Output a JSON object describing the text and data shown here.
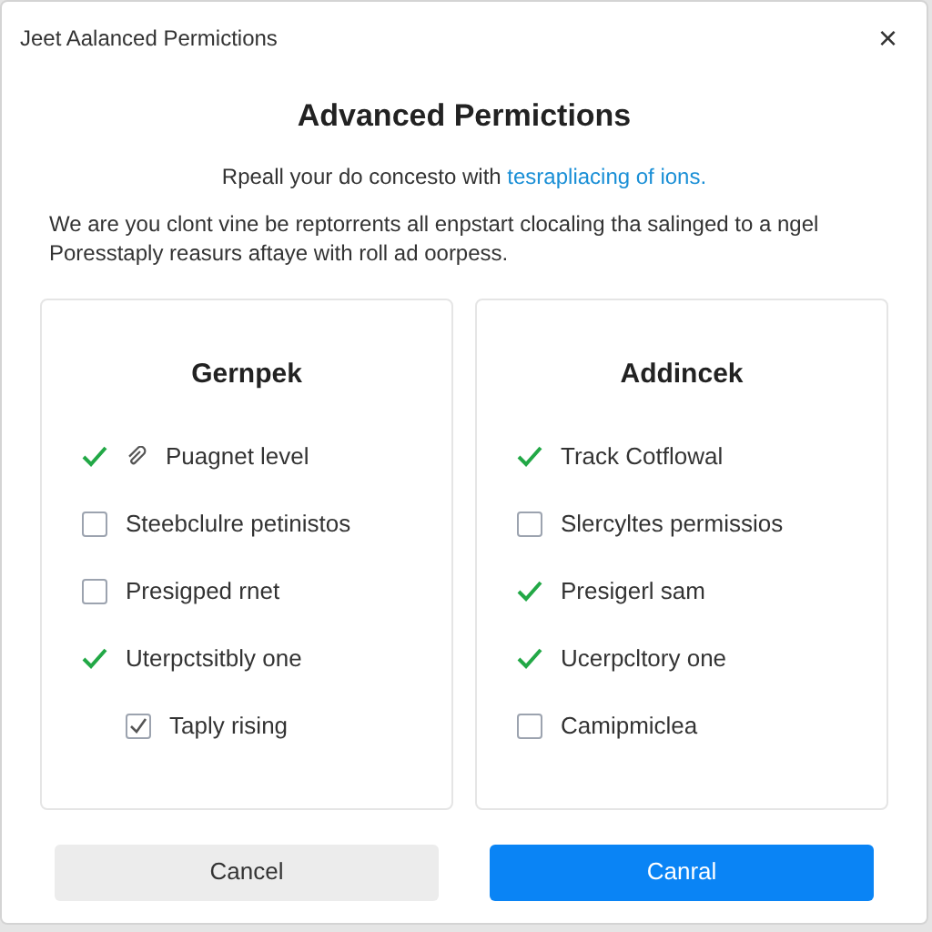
{
  "window": {
    "title": "Jeet Aalanced Permictions",
    "close": "×"
  },
  "heading": "Advanced Permictions",
  "subtitle": {
    "text": "Rpeall your do concesto with ",
    "link": "tesrapliacing of ions."
  },
  "description": "We are you clont vine be reptorrents all enpstart clocaling tha salinged to a ngel Poresstaply reasurs aftaye with roll ad oorpess.",
  "panels": [
    {
      "title": "Gernpek",
      "items": [
        {
          "kind": "attach",
          "label": "Puagnet level",
          "checked": true
        },
        {
          "kind": "box",
          "label": "Steebclulre petinistos",
          "checked": false
        },
        {
          "kind": "box",
          "label": "Presigped rnet",
          "checked": false
        },
        {
          "kind": "mark",
          "label": "Uterpctsitbly one",
          "checked": true,
          "children": [
            {
              "kind": "box",
              "label": "Taply rising",
              "checked": true
            }
          ]
        }
      ]
    },
    {
      "title": "Addincek",
      "items": [
        {
          "kind": "mark",
          "label": "Track Cotflowal",
          "checked": true
        },
        {
          "kind": "box",
          "label": "Slercyltes permissios",
          "checked": false
        },
        {
          "kind": "mark",
          "label": "Presigerl sam",
          "checked": true
        },
        {
          "kind": "mark",
          "label": "Ucerpcltory one",
          "checked": true
        },
        {
          "kind": "box",
          "label": "Camipmiclea",
          "checked": false
        }
      ]
    }
  ],
  "buttons": [
    {
      "label": "Cancel",
      "primary": false
    },
    {
      "label": "Canral",
      "primary": true
    }
  ]
}
